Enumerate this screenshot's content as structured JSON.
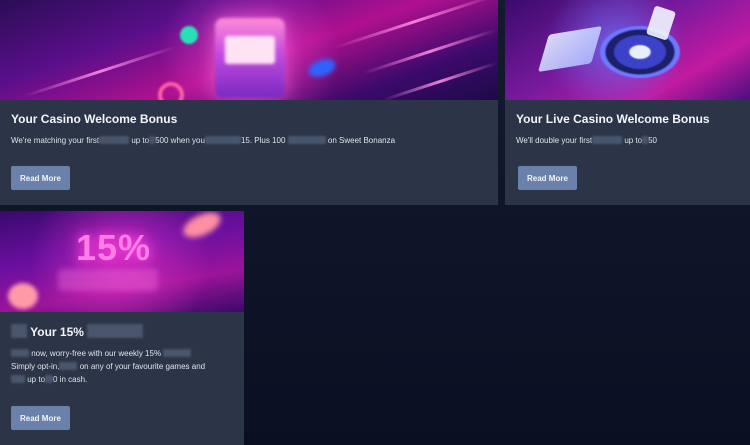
{
  "cards": [
    {
      "title": "Your Casino Welcome Bonus",
      "desc_1": "We're matching your first",
      "desc_2": "up to",
      "desc_3": "500 when you",
      "desc_4": "15. Plus 100",
      "desc_5": "on Sweet Bonanza",
      "button_label": "Read More"
    },
    {
      "title": "Your Live Casino Welcome Bonus",
      "desc_1": "We'll double your first",
      "desc_2": "up to",
      "desc_3": "50",
      "button_label": "Read More"
    },
    {
      "banner_text": "15%",
      "title": "Your 15%",
      "desc_line1_a": "now, worry-free with our weekly 15%",
      "desc_line2_a": "Simply opt-in,",
      "desc_line2_b": "on any of your favourite games and",
      "desc_line3_a": "up to",
      "desc_line3_b": "0 in cash.",
      "button_label": "Read More"
    }
  ],
  "colors": {
    "card_bg": "#2b3547",
    "button_bg": "#6a82aa",
    "page_bg": "#0b0f22"
  }
}
